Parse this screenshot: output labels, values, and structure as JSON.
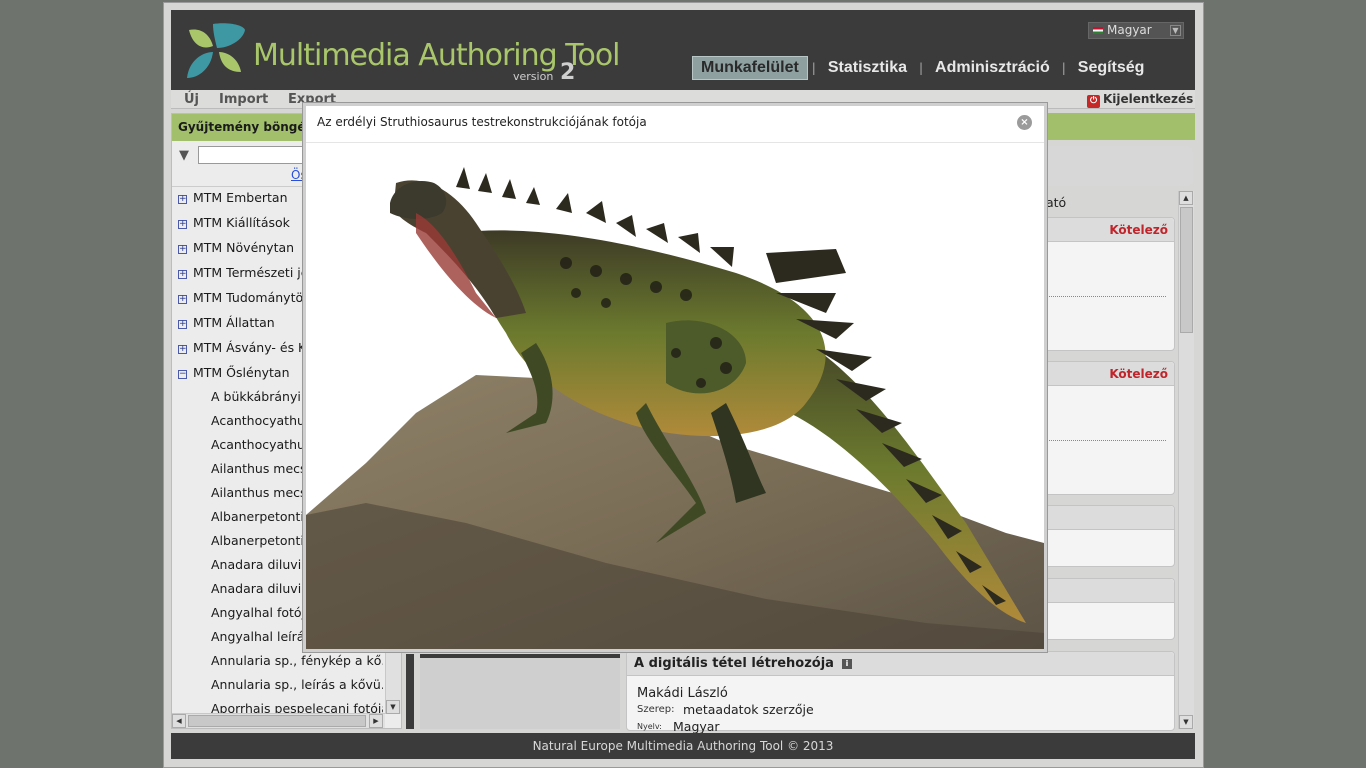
{
  "app": {
    "name": "Multimedia Authoring Tool",
    "version_label": "version",
    "version_number": "2",
    "colors": {
      "header": "#3b3b3b",
      "accent_green": "#a2bf6b",
      "required_red": "#c0252b"
    }
  },
  "language": {
    "selected": "Magyar",
    "icon": "hungary-flag-icon"
  },
  "nav": {
    "items": [
      {
        "label": "Munkafelület",
        "active": true
      },
      {
        "label": "Statisztika",
        "active": false
      },
      {
        "label": "Adminisztráció",
        "active": false
      },
      {
        "label": "Segítség",
        "active": false
      }
    ]
  },
  "menubar": {
    "new": "Új",
    "import": "Import",
    "export": "Export",
    "logout": "Kijelentkezés"
  },
  "left_panel": {
    "title": "Gyűjtemény böngésző",
    "reset_link": "Ös",
    "tree": [
      {
        "label": "MTM Embertan",
        "toggle": "+",
        "level": 0
      },
      {
        "label": "MTM Kiállítások",
        "toggle": "+",
        "level": 0
      },
      {
        "label": "MTM Növénytan",
        "toggle": "+",
        "level": 0
      },
      {
        "label": "MTM Természeti je",
        "toggle": "+",
        "level": 0
      },
      {
        "label": "MTM Tudománytör",
        "toggle": "+",
        "level": 0
      },
      {
        "label": "MTM Állattan",
        "toggle": "+",
        "level": 0
      },
      {
        "label": "MTM Ásvány- és K",
        "toggle": "+",
        "level": 0
      },
      {
        "label": "MTM Őslénytan",
        "toggle": "−",
        "level": 0
      },
      {
        "label": "A bükkábrányi e",
        "level": 1
      },
      {
        "label": "Acanthocyathus",
        "level": 1
      },
      {
        "label": "Acanthocyathus",
        "level": 1
      },
      {
        "label": "Ailanthus mecse",
        "level": 1
      },
      {
        "label": "Ailanthus mecse",
        "level": 1
      },
      {
        "label": "Albanerpetontida",
        "level": 1
      },
      {
        "label": "Albanerpetontida",
        "level": 1
      },
      {
        "label": "Anadara diluvii fo",
        "level": 1
      },
      {
        "label": "Anadara diluvii le",
        "level": 1
      },
      {
        "label": "Angyalhal fotója",
        "level": 1
      },
      {
        "label": "Angyalhal leírás",
        "level": 1
      },
      {
        "label": "Annularia sp., fénykép a kő...",
        "level": 1
      },
      {
        "label": "Annularia sp., leírás a kővü...",
        "level": 1
      },
      {
        "label": "Aporrhais pespelecani fotója",
        "level": 1
      }
    ]
  },
  "main": {
    "hint_text": "ató",
    "required_label": "Kötelező",
    "creator": {
      "title": "A digitális tétel létrehozója",
      "name": "Makádi László",
      "role_label": "Szerep:",
      "role_value": "metaadatok szerzője",
      "lang_label": "Nyelv:",
      "lang_value": "Magyar"
    }
  },
  "footer": {
    "text": "Natural Europe Multimedia Authoring Tool © 2013"
  },
  "modal": {
    "title": "Az erdélyi Struthiosaurus testrekonstrukciójának fotója",
    "close_icon": "close-circle-icon",
    "image_subject": "dinosaur-sculpture-image"
  }
}
